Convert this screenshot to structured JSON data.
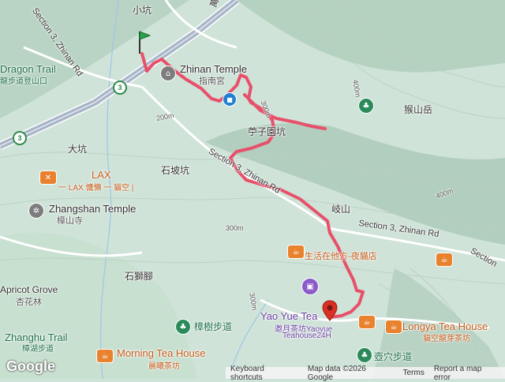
{
  "map": {
    "colors": {
      "terrain": "#cfe3d8",
      "ridge": "#9fbfae",
      "valley": "#e4f0e8",
      "highway": "#a9b6c9",
      "route": "#e8506a",
      "start": "#2aa14a",
      "end": "#d93025"
    },
    "labels": {
      "xiaokeng": "小坑",
      "road_top": "萬壽路",
      "dragon_trail": "Dragon Trail",
      "dragon_trail_zh": "龍步道登山口",
      "zhinan_road_vertical": "Section 3, Zhinan Rd",
      "zhinan_temple": "Zhinan Temple",
      "zhinan_temple_zh": "指南宮",
      "elev_400_top": "400m",
      "houshan": "猴山岳",
      "elev_200": "200m",
      "elev_300_a": "300m",
      "zhuziwokeng": "苧子園坑",
      "dakeng": "大坑",
      "shipokeng": "石坡坑",
      "lax": "LAX",
      "lax_zh": "一 LAX 慵懶 一 貓空 |",
      "zhinan_road_diag": "Section 3, Zhinan Rd",
      "zhangshan_temple": "Zhangshan Temple",
      "zhangshan_temple_zh": "樟山寺",
      "elev_400_right": "400m",
      "qishan": "岐山",
      "elev_300_b": "300m",
      "zhinan_road_right": "Section 3, Zhinan Rd",
      "shenghuo": "生活在他方-夜貓店",
      "section_right": "Section",
      "shishijiao": "石獅腳",
      "apricot_grove": "Apricot Grove",
      "apricot_grove_zh": "杏花林",
      "yaoyue_tea": "Yao Yue Tea",
      "yaoyue_tea_zh": "邀月茶坊Yaoyue",
      "yaoyue_tea_24": "Teahouse24H",
      "elev_300_c": "300m",
      "zhangshu_trail": "樟樹步道",
      "longya_tea": "Longya Tea House",
      "longya_tea_zh": "貓空龍芽茶坊",
      "zhanghu_trail": "Zhanghu Trail",
      "zhanghu_trail_zh": "樟湖步道",
      "morning_tea": "Morning Tea House",
      "morning_tea_zh": "晨曦茶坊",
      "huxue_trail": "壺穴步道"
    },
    "shield_3": "3",
    "icons": {
      "temple": "temple-icon",
      "park": "park-icon",
      "restaurant": "restaurant-icon",
      "cafe": "cafe-icon",
      "hotel": "hotel-icon",
      "start": "start-flag-icon",
      "end": "end-pin-icon"
    }
  },
  "footer": {
    "google": "Google",
    "shortcuts": "Keyboard shortcuts",
    "map_data": "Map data ©2026 Google",
    "terms": "Terms",
    "report": "Report a map error"
  }
}
